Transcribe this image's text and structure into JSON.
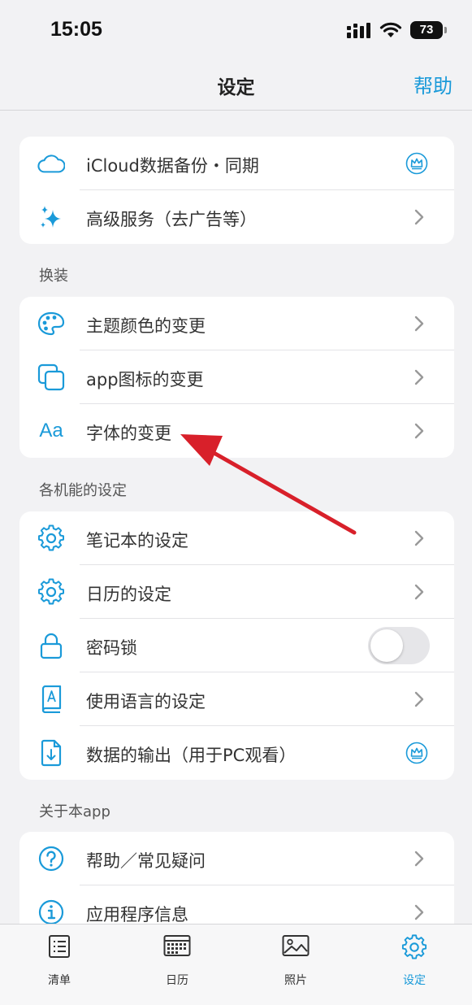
{
  "status_bar": {
    "time": "15:05",
    "battery": "73"
  },
  "nav": {
    "title": "设定",
    "help": "帮助"
  },
  "colors": {
    "accent": "#1a9ad9",
    "annotation_arrow": "#d8202a"
  },
  "group_top": {
    "items": [
      {
        "label": "iCloud数据备份・同期",
        "icon": "cloud-icon",
        "trailing": "crown-icon"
      },
      {
        "label": "高级服务（去广告等）",
        "icon": "sparkle-icon",
        "trailing": "chevron-right-icon"
      }
    ]
  },
  "section_customize": {
    "header": "换装",
    "items": [
      {
        "label": "主题颜色的变更",
        "icon": "palette-icon",
        "trailing": "chevron-right-icon"
      },
      {
        "label": "app图标的变更",
        "icon": "copy-icon",
        "trailing": "chevron-right-icon"
      },
      {
        "label": "字体的变更",
        "icon_text": "Aa",
        "trailing": "chevron-right-icon"
      }
    ]
  },
  "section_functions": {
    "header": "各机能的设定",
    "items": [
      {
        "label": "笔记本的设定",
        "icon": "gear-icon",
        "trailing": "chevron-right-icon"
      },
      {
        "label": "日历的设定",
        "icon": "gear-icon",
        "trailing": "chevron-right-icon"
      },
      {
        "label": "密码锁",
        "icon": "lock-icon",
        "trailing": "toggle",
        "toggle_on": false
      },
      {
        "label": "使用语言的设定",
        "icon": "language-book-icon",
        "trailing": "chevron-right-icon"
      },
      {
        "label": "数据的输出（用于PC观看）",
        "icon": "file-download-icon",
        "trailing": "crown-icon"
      }
    ]
  },
  "section_about": {
    "header": "关于本app",
    "items": [
      {
        "label": "帮助／常见疑问",
        "icon": "question-icon",
        "trailing": "chevron-right-icon"
      },
      {
        "label": "应用程序信息",
        "icon": "info-icon",
        "trailing": "chevron-right-icon"
      }
    ]
  },
  "tab_bar": {
    "tabs": [
      {
        "label": "清单",
        "icon": "list-icon",
        "active": false
      },
      {
        "label": "日历",
        "icon": "calendar-icon",
        "active": false
      },
      {
        "label": "照片",
        "icon": "photo-icon",
        "active": false
      },
      {
        "label": "设定",
        "icon": "gear-icon",
        "active": true
      }
    ]
  }
}
